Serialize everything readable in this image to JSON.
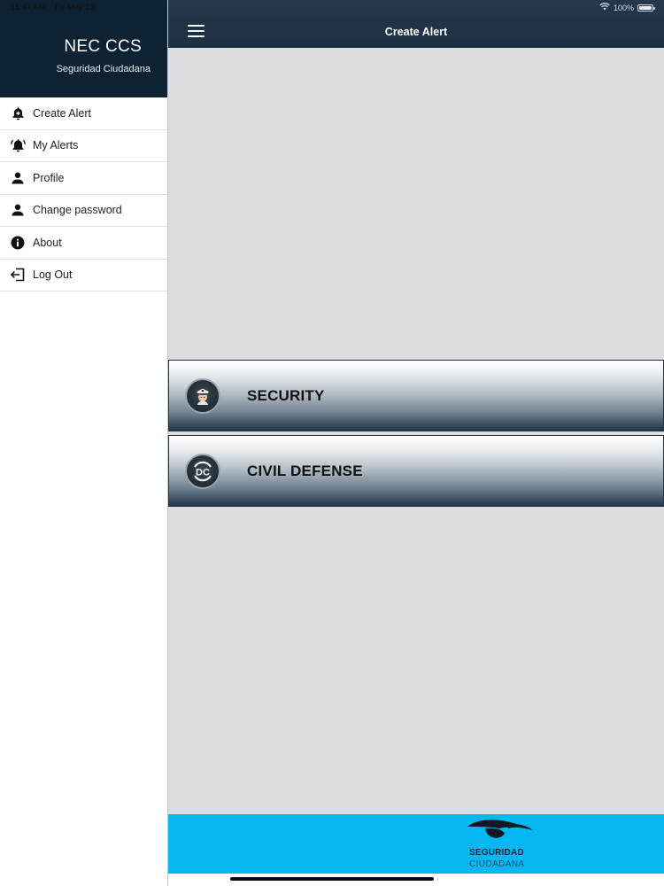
{
  "status_bar": {
    "time": "11:47 AM",
    "date": "Fri May 10",
    "battery": "100%"
  },
  "sidebar": {
    "title": "NEC CCS",
    "subtitle": "Seguridad Ciudadana",
    "items": [
      {
        "label": "Create Alert",
        "icon": "bell-plus-icon"
      },
      {
        "label": "My Alerts",
        "icon": "ringing-bell-icon"
      },
      {
        "label": "Profile",
        "icon": "person-icon"
      },
      {
        "label": "Change password",
        "icon": "person-icon"
      },
      {
        "label": "About",
        "icon": "info-icon"
      },
      {
        "label": "Log Out",
        "icon": "logout-icon"
      }
    ]
  },
  "header": {
    "title": "Create Alert"
  },
  "alerts": [
    {
      "label": "SECURITY",
      "icon": "police-officer-icon"
    },
    {
      "label": "CIVIL DEFENSE",
      "icon": "civil-defense-dc-icon"
    }
  ],
  "footer": {
    "logo_line1": "SEGURIDAD",
    "logo_line2": "CIUDADANA"
  },
  "colors": {
    "sidebar_header": "#0d2333",
    "navbar": "#1f3446",
    "content_bg": "#dddce1",
    "footer": "#05b8f2"
  }
}
